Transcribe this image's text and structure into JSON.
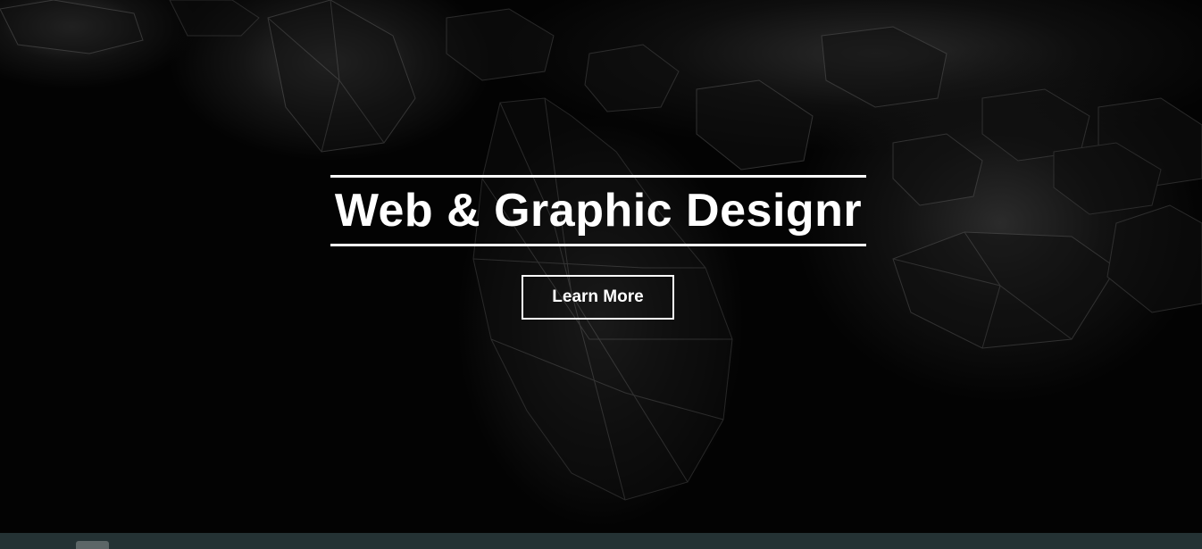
{
  "hero": {
    "background_image": "dark diamonds photo",
    "title": "Web & Graphic Designr",
    "cta_label": "Learn More"
  },
  "colors": {
    "title": "#ffffff",
    "background": "#030303",
    "bottom_bar": "#243234",
    "bottom_tab": "#5c6667"
  }
}
